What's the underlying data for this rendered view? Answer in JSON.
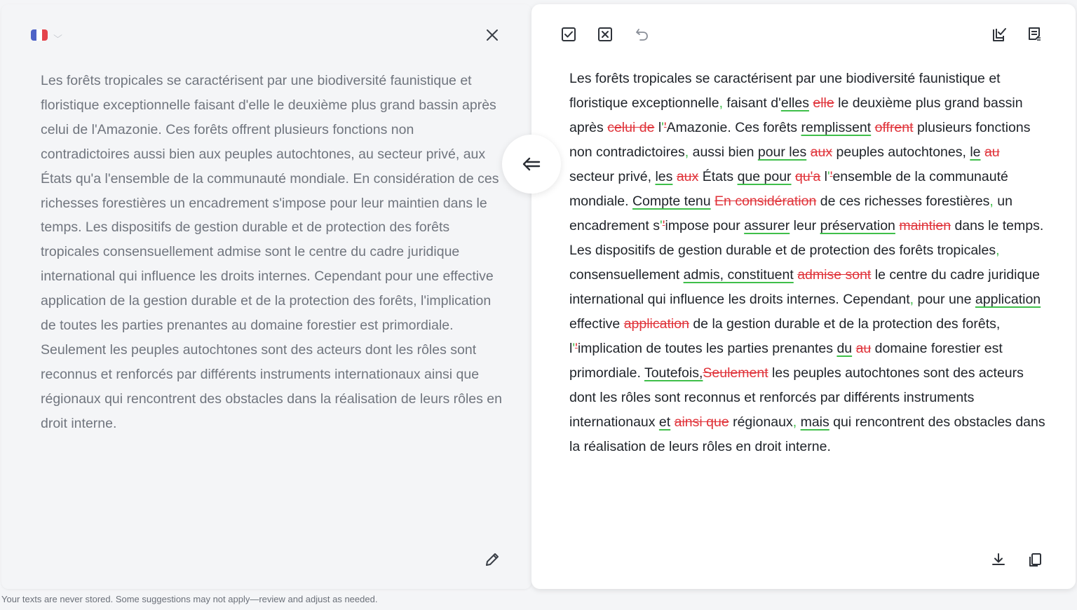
{
  "source_panel": {
    "language_flag_colors": [
      "#4f63c7",
      "#ffffff",
      "#e4434b"
    ],
    "text": "Les forêts tropicales se caractérisent par une biodiversité faunistique et floristique exceptionnelle faisant d'elle le deuxième plus grand bassin après celui de l'Amazonie. Ces forêts offrent plusieurs fonctions non contradictoires aussi bien aux peuples autochtones, au secteur privé, aux États qu'a l'ensemble de la communauté mondiale. En considération de ces richesses forestières un encadrement s'impose pour leur maintien dans le temps. Les dispositifs de gestion durable et de protection des forêts tropicales consensuellement admise sont le centre du cadre juridique international qui influence les droits internes. Cependant pour une effective application de la gestion durable et de la protection des forêts, l'implication de toutes les parties prenantes au domaine forestier est primordiale. Seulement les peuples autochtones sont des acteurs dont les rôles sont reconnus et renforcés par différents instruments internationaux ainsi que régionaux qui rencontrent des obstacles dans la réalisation de leurs rôles en droit interne."
  },
  "result_panel": {
    "segments": [
      {
        "t": "n",
        "v": "Les forêts tropicales se caractérisent par une biodiversité faunistique et floristique exceptionnelle"
      },
      {
        "t": "p",
        "v": ","
      },
      {
        "t": "n",
        "v": " faisant d'"
      },
      {
        "t": "i",
        "v": "elles"
      },
      {
        "t": "n",
        "v": " "
      },
      {
        "t": "d",
        "v": "elle"
      },
      {
        "t": "n",
        "v": " le deuxième plus grand bassin après "
      },
      {
        "t": "d",
        "v": "celui de"
      },
      {
        "t": "n",
        "v": " l"
      },
      {
        "t": "p",
        "v": "'"
      },
      {
        "t": "d",
        "v": "'"
      },
      {
        "t": "n",
        "v": "Amazonie. Ces forêts "
      },
      {
        "t": "i",
        "v": "remplissent"
      },
      {
        "t": "n",
        "v": " "
      },
      {
        "t": "d",
        "v": "offrent"
      },
      {
        "t": "n",
        "v": " plusieurs fonctions non contradictoires"
      },
      {
        "t": "p",
        "v": ","
      },
      {
        "t": "n",
        "v": " aussi bien "
      },
      {
        "t": "i",
        "v": "pour les"
      },
      {
        "t": "n",
        "v": " "
      },
      {
        "t": "d",
        "v": "aux"
      },
      {
        "t": "n",
        "v": " peuples autochtones, "
      },
      {
        "t": "i",
        "v": "le"
      },
      {
        "t": "n",
        "v": " "
      },
      {
        "t": "d",
        "v": "au"
      },
      {
        "t": "n",
        "v": " secteur privé, "
      },
      {
        "t": "i",
        "v": "les"
      },
      {
        "t": "n",
        "v": " "
      },
      {
        "t": "d",
        "v": "aux"
      },
      {
        "t": "n",
        "v": " États "
      },
      {
        "t": "i",
        "v": "que pour"
      },
      {
        "t": "n",
        "v": " "
      },
      {
        "t": "d",
        "v": "qu'a"
      },
      {
        "t": "n",
        "v": " l"
      },
      {
        "t": "p",
        "v": "'"
      },
      {
        "t": "d",
        "v": "'"
      },
      {
        "t": "n",
        "v": "ensemble de la communauté mondiale. "
      },
      {
        "t": "i",
        "v": "Compte tenu"
      },
      {
        "t": "n",
        "v": " "
      },
      {
        "t": "d",
        "v": "En considération"
      },
      {
        "t": "n",
        "v": " de ces richesses forestières"
      },
      {
        "t": "p",
        "v": ","
      },
      {
        "t": "n",
        "v": " un encadrement s"
      },
      {
        "t": "p",
        "v": "'"
      },
      {
        "t": "d",
        "v": "'"
      },
      {
        "t": "n",
        "v": "impose pour "
      },
      {
        "t": "i",
        "v": "assurer"
      },
      {
        "t": "n",
        "v": " leur "
      },
      {
        "t": "i",
        "v": "préservation"
      },
      {
        "t": "n",
        "v": " "
      },
      {
        "t": "d",
        "v": "maintien"
      },
      {
        "t": "n",
        "v": " dans le temps. Les dispositifs de gestion durable et de protection des forêts tropicales"
      },
      {
        "t": "p",
        "v": ","
      },
      {
        "t": "n",
        "v": " consensuellement "
      },
      {
        "t": "i",
        "v": "admis, constituent"
      },
      {
        "t": "n",
        "v": " "
      },
      {
        "t": "d",
        "v": "admise sont"
      },
      {
        "t": "n",
        "v": " le centre du cadre juridique international qui influence les droits internes. Cependant"
      },
      {
        "t": "p",
        "v": ","
      },
      {
        "t": "n",
        "v": " pour une "
      },
      {
        "t": "i",
        "v": "application"
      },
      {
        "t": "n",
        "v": " effective "
      },
      {
        "t": "d",
        "v": "application"
      },
      {
        "t": "n",
        "v": " de la gestion durable et de la protection des forêts, l"
      },
      {
        "t": "p",
        "v": "'"
      },
      {
        "t": "d",
        "v": "'"
      },
      {
        "t": "n",
        "v": "implication de toutes les parties prenantes "
      },
      {
        "t": "i",
        "v": "du"
      },
      {
        "t": "n",
        "v": " "
      },
      {
        "t": "d",
        "v": "au"
      },
      {
        "t": "n",
        "v": " domaine forestier est primordiale. "
      },
      {
        "t": "i",
        "v": "Toutefois,"
      },
      {
        "t": "d",
        "v": "Seulement"
      },
      {
        "t": "n",
        "v": " les peuples autochtones sont des acteurs dont les rôles sont reconnus et renforcés par différents instruments internationaux "
      },
      {
        "t": "i",
        "v": "et"
      },
      {
        "t": "n",
        "v": " "
      },
      {
        "t": "d",
        "v": "ainsi que"
      },
      {
        "t": "n",
        "v": " régionaux"
      },
      {
        "t": "p",
        "v": ","
      },
      {
        "t": "n",
        "v": " "
      },
      {
        "t": "i",
        "v": "mais"
      },
      {
        "t": "n",
        "v": " qui rencontrent des obstacles dans la réalisation de leurs rôles en droit interne."
      }
    ]
  },
  "colors": {
    "insert_underline": "#3fbf4a",
    "delete_text": "#e0333a"
  },
  "footer": {
    "note": "Your texts are never stored. Some suggestions may not apply—review and adjust as needed."
  }
}
